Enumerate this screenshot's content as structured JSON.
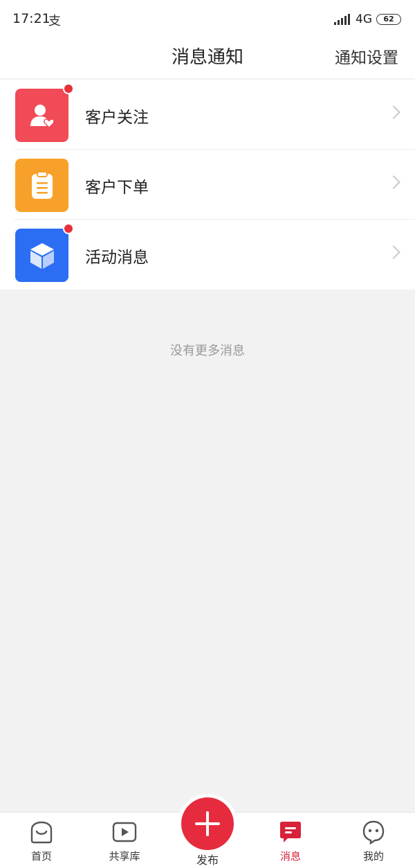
{
  "status_bar": {
    "time": "17:21",
    "carrier_icon": "支",
    "network": "4G",
    "battery": "62"
  },
  "header": {
    "title": "消息通知",
    "settings_label": "通知设置"
  },
  "notifications": [
    {
      "label": "客户关注",
      "icon": "customer-follow-icon",
      "color": "#f04b57",
      "unread": true
    },
    {
      "label": "客户下单",
      "icon": "clipboard-icon",
      "color": "#f7a12a",
      "unread": false
    },
    {
      "label": "活动消息",
      "icon": "cube-icon",
      "color": "#2b6ef4",
      "unread": true
    }
  ],
  "empty_text": "没有更多消息",
  "tabbar": {
    "items": [
      {
        "label": "首页",
        "icon": "home-bag-icon",
        "active": false
      },
      {
        "label": "共享库",
        "icon": "play-icon",
        "active": false
      },
      {
        "label": "发布",
        "icon": "plus-icon",
        "active": false
      },
      {
        "label": "消息",
        "icon": "message-icon",
        "active": true
      },
      {
        "label": "我的",
        "icon": "profile-face-icon",
        "active": false
      }
    ],
    "accent": "#e62b3f"
  }
}
